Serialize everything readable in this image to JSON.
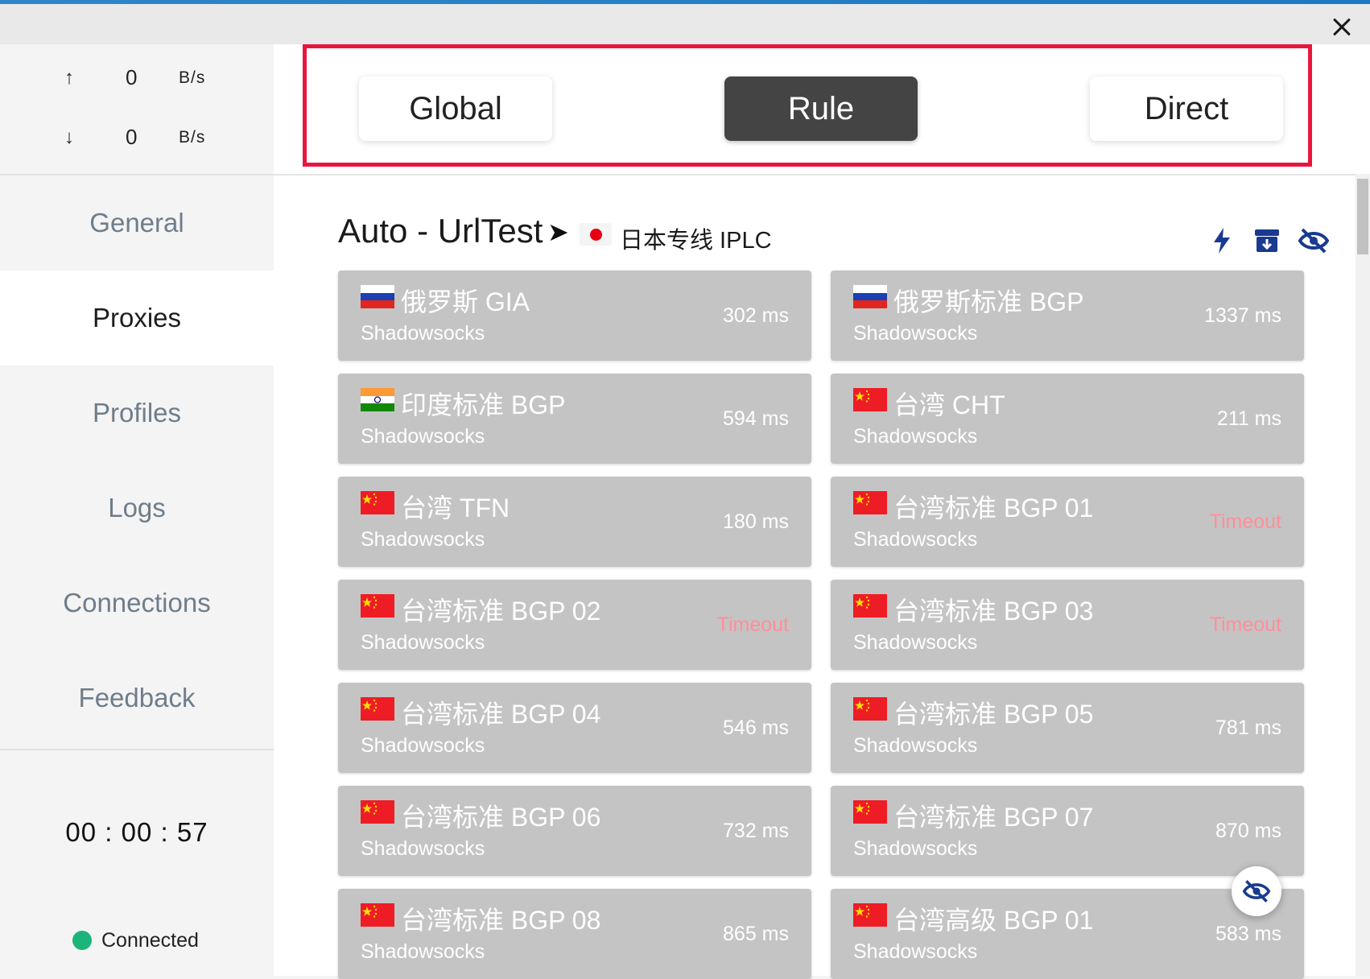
{
  "window": {
    "close_label": "×"
  },
  "traffic": {
    "upload": {
      "arrow": "↑",
      "value": "0",
      "unit": "B/s"
    },
    "download": {
      "arrow": "↓",
      "value": "0",
      "unit": "B/s"
    }
  },
  "nav": {
    "items": [
      {
        "label": "General",
        "active": false
      },
      {
        "label": "Proxies",
        "active": true
      },
      {
        "label": "Profiles",
        "active": false
      },
      {
        "label": "Logs",
        "active": false
      },
      {
        "label": "Connections",
        "active": false
      },
      {
        "label": "Feedback",
        "active": false
      }
    ]
  },
  "session": {
    "elapsed": "00 : 00 : 57",
    "status": "Connected",
    "status_color": "#1db47a"
  },
  "modes": {
    "options": [
      "Global",
      "Rule",
      "Direct"
    ],
    "selected": "Rule",
    "highlight_color": "#e8163f"
  },
  "group": {
    "title": "Auto - UrlTest",
    "arrow": "➤",
    "selected_proxy": "日本专线 IPLC",
    "selected_flag": "japan-flag-icon",
    "actions": [
      "lightning-icon",
      "archive-icon",
      "eye-off-icon"
    ],
    "accent_color": "#1a3a8f"
  },
  "proxies": [
    {
      "name": "俄罗斯 GIA",
      "type": "Shadowsocks",
      "latency": "302 ms",
      "flag": "russia",
      "timeout": false
    },
    {
      "name": "俄罗斯标准 BGP",
      "type": "Shadowsocks",
      "latency": "1337 ms",
      "flag": "russia",
      "timeout": false
    },
    {
      "name": "印度标准 BGP",
      "type": "Shadowsocks",
      "latency": "594 ms",
      "flag": "india",
      "timeout": false
    },
    {
      "name": "台湾 CHT",
      "type": "Shadowsocks",
      "latency": "211 ms",
      "flag": "china",
      "timeout": false
    },
    {
      "name": "台湾 TFN",
      "type": "Shadowsocks",
      "latency": "180 ms",
      "flag": "china",
      "timeout": false
    },
    {
      "name": "台湾标准 BGP 01",
      "type": "Shadowsocks",
      "latency": "Timeout",
      "flag": "china",
      "timeout": true
    },
    {
      "name": "台湾标准 BGP 02",
      "type": "Shadowsocks",
      "latency": "Timeout",
      "flag": "china",
      "timeout": true
    },
    {
      "name": "台湾标准 BGP 03",
      "type": "Shadowsocks",
      "latency": "Timeout",
      "flag": "china",
      "timeout": true
    },
    {
      "name": "台湾标准 BGP 04",
      "type": "Shadowsocks",
      "latency": "546 ms",
      "flag": "china",
      "timeout": false
    },
    {
      "name": "台湾标准 BGP 05",
      "type": "Shadowsocks",
      "latency": "781 ms",
      "flag": "china",
      "timeout": false
    },
    {
      "name": "台湾标准 BGP 06",
      "type": "Shadowsocks",
      "latency": "732 ms",
      "flag": "china",
      "timeout": false
    },
    {
      "name": "台湾标准 BGP 07",
      "type": "Shadowsocks",
      "latency": "870 ms",
      "flag": "china",
      "timeout": false
    },
    {
      "name": "台湾标准 BGP 08",
      "type": "Shadowsocks",
      "latency": "865 ms",
      "flag": "china",
      "timeout": false
    },
    {
      "name": "台湾高级 BGP 01",
      "type": "Shadowsocks",
      "latency": "583 ms",
      "flag": "china",
      "timeout": false
    }
  ],
  "fab": {
    "icon": "eye-off-icon"
  }
}
